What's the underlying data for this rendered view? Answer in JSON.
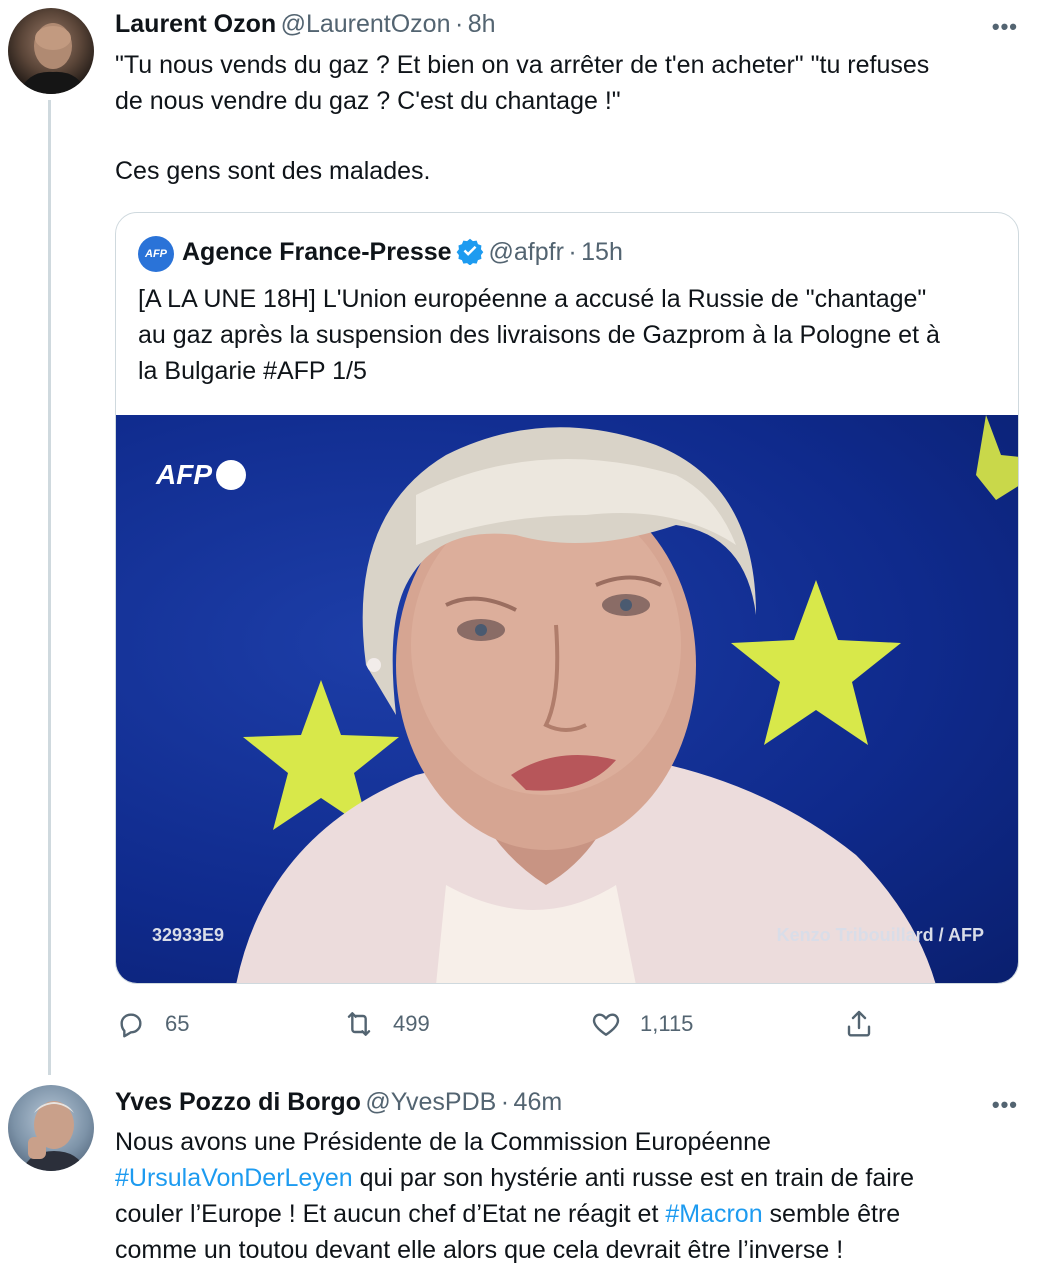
{
  "tweet1": {
    "name": "Laurent Ozon",
    "handle": "@LaurentOzon",
    "time": "8h",
    "line1": "\"Tu nous vends du gaz ? Et bien on va arrêter de t'en acheter\" \"tu refuses",
    "line2": "de nous vendre du gaz ? C'est du chantage !\"",
    "line3": "Ces gens sont des malades.",
    "quoted": {
      "avatar_text": "AFP",
      "name": "Agence France-Presse",
      "handle": "@afpfr",
      "time": "15h",
      "line1": "[A LA UNE 18H] L'Union européenne a accusé la Russie de \"chantage\"",
      "line2": "au gaz après la suspension des livraisons de Gazprom à la Pologne et à",
      "line3": "la Bulgarie #AFP 1/5",
      "image": {
        "watermark": "AFP",
        "photo_id": "32933E9",
        "credit": "Kenzo Tribouillard / AFP"
      }
    },
    "actions": {
      "replies": "65",
      "retweets": "499",
      "likes": "1,115"
    }
  },
  "tweet2": {
    "name": "Yves Pozzo di Borgo",
    "handle": "@YvesPDB",
    "time": "46m",
    "line1": "Nous avons une Présidente de la Commission Européenne",
    "hashtag1": "#UrsulaVonDerLeyen",
    "line2_rest": " qui par son hystérie anti russe est en train de faire",
    "line3_start": "couler l’Europe ! Et aucun chef d’Etat ne réagit et ",
    "hashtag2": "#Macron",
    "line3_end": " semble être",
    "line4": "comme un toutou devant elle alors que cela devrait être l’inverse !"
  },
  "more_label": "•••",
  "separator": "·",
  "colors": {
    "link": "#1d9bf0",
    "text": "#0f1419",
    "muted": "#536471",
    "border": "#cfd9de",
    "verified": "#1d9bf0"
  }
}
